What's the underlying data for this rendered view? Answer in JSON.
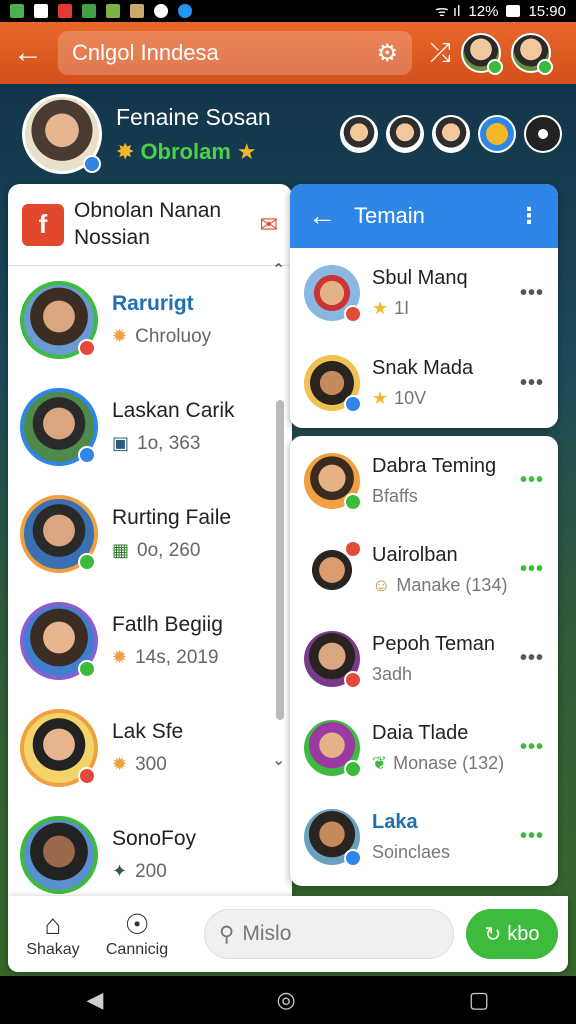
{
  "status_bar": {
    "signal": "ᯤ ıl",
    "battery_pct": "12%",
    "time": "15:90"
  },
  "app_bar": {
    "search_text": "Cnlgol Inndesa",
    "icons": [
      "back-arrow-icon",
      "gear-icon",
      "share-icon"
    ]
  },
  "profile": {
    "name": "Fenaine Sosan",
    "status": "Obrolam"
  },
  "left_panel": {
    "title": "Obnolan Nanan Nossian",
    "items": [
      {
        "name": "Rarurigt",
        "sub": "Chroluoy",
        "highlight": true
      },
      {
        "name": "Laskan Carik",
        "sub": "1o,  363",
        "highlight": false
      },
      {
        "name": "Rurting Faile",
        "sub": "0o,  260",
        "highlight": false
      },
      {
        "name": "Fatlh Begiig",
        "sub": "14s, 2019",
        "highlight": false
      },
      {
        "name": "Lak Sfe",
        "sub": "300",
        "highlight": false
      },
      {
        "name": "SonoFoy",
        "sub": "200",
        "highlight": false
      }
    ]
  },
  "right_panel_top": {
    "title": "Temain",
    "items": [
      {
        "name": "Sbul Manq",
        "sub": "1I"
      },
      {
        "name": "Snak Mada",
        "sub": "10V"
      }
    ]
  },
  "right_panel_bottom": {
    "items": [
      {
        "name": "Dabra Teming",
        "sub": "Bfaffs"
      },
      {
        "name": "Uairolban",
        "sub": "Manake (134)"
      },
      {
        "name": "Pepoh Teman",
        "sub": "3adh"
      },
      {
        "name": "Daia Tlade",
        "sub": "Monase (132)"
      },
      {
        "name": "Laka",
        "sub": "Soinclaes"
      }
    ]
  },
  "bottom_bar": {
    "tab1": "Shakay",
    "tab2": "Cannicig",
    "search_placeholder": "Mislo",
    "go_label": "kbo"
  },
  "colors": {
    "accent_orange": "#e0582a",
    "accent_blue": "#2f86e6",
    "online_green": "#3dbb3d"
  }
}
